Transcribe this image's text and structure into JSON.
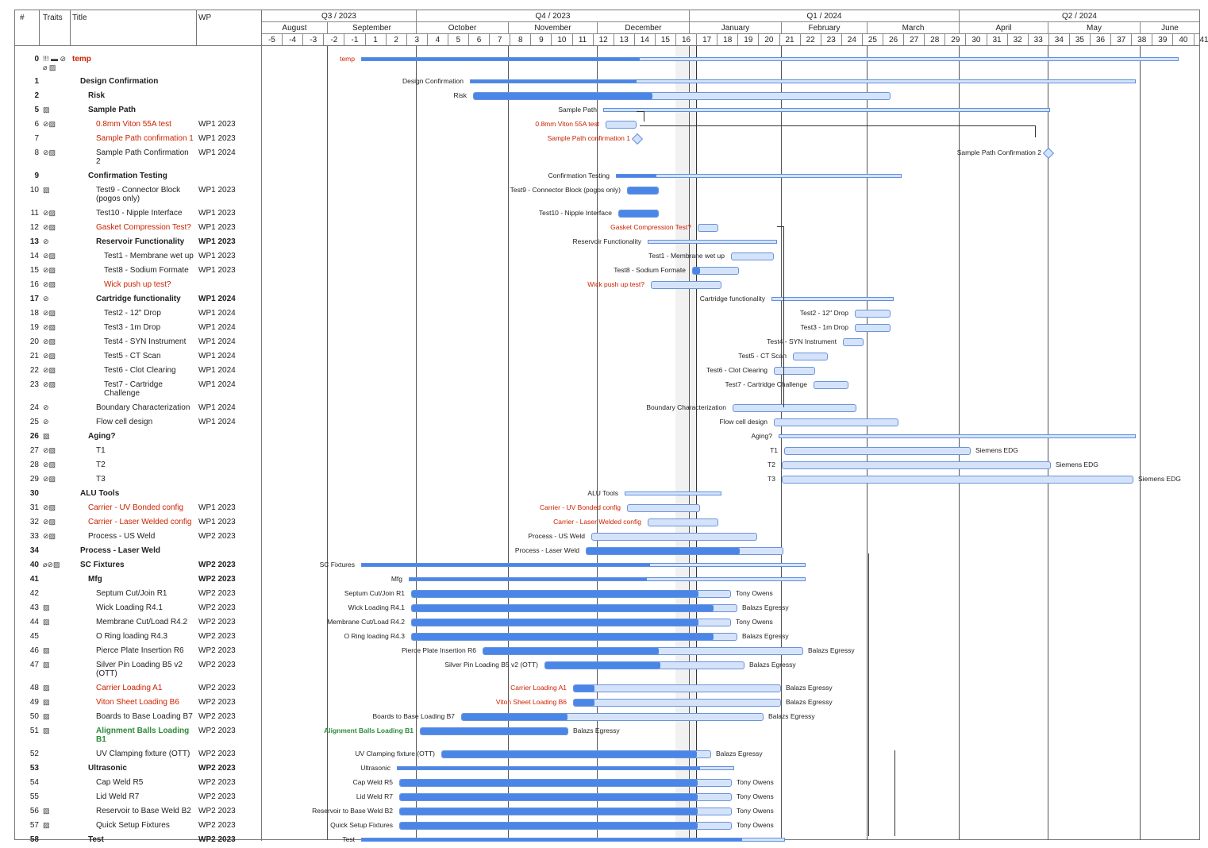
{
  "columns": {
    "num": "#",
    "traits": "Traits",
    "title": "Title",
    "wp": "WP"
  },
  "quarters": [
    "Q3 / 2023",
    "Q4 / 2023",
    "Q1 / 2024",
    "Q2 / 2024"
  ],
  "months": [
    "August",
    "September",
    "October",
    "November",
    "December",
    "January",
    "February",
    "March",
    "April",
    "May",
    "June"
  ],
  "weeks": [
    "-5",
    "-4",
    "-3",
    "-2",
    "-1",
    "1",
    "2",
    "3",
    "4",
    "5",
    "6",
    "7",
    "8",
    "9",
    "10",
    "11",
    "12",
    "13",
    "14",
    "15",
    "16",
    "17",
    "18",
    "19",
    "20",
    "21",
    "22",
    "23",
    "24",
    "25",
    "26",
    "27",
    "28",
    "29",
    "30",
    "31",
    "32",
    "33",
    "34",
    "35",
    "36",
    "37",
    "38",
    "39",
    "40",
    "41"
  ],
  "rows": [
    {
      "num": "0",
      "traits": "!!! ▬ ⊘ ⌀ ▨",
      "title": "temp",
      "wp": "",
      "style": "red-bold",
      "bar": "temp"
    },
    {
      "num": "1",
      "traits": "",
      "title": "Design Confirmation",
      "wp": "",
      "style": "bold",
      "bar": "Design Confirmation"
    },
    {
      "num": "2",
      "traits": "",
      "title": "Risk",
      "wp": "",
      "style": "bold",
      "bar": "Risk"
    },
    {
      "num": "5",
      "traits": "▨",
      "title": "Sample Path",
      "wp": "",
      "style": "bold",
      "bar": "Sample Path"
    },
    {
      "num": "6",
      "traits": "⊘▨",
      "title": "0.8mm Viton 55A test",
      "wp": "WP1 2023",
      "style": "red",
      "bar": "0.8mm Viton 55A test"
    },
    {
      "num": "7",
      "traits": "",
      "title": "Sample Path confirmation 1",
      "wp": "WP1 2023",
      "style": "red",
      "bar": "Sample Path confirmation 1"
    },
    {
      "num": "8",
      "traits": "⊘▨",
      "title": "Sample Path Confirmation 2",
      "wp": "WP1 2024",
      "style": "",
      "bar": "Sample Path Confirmation 2"
    },
    {
      "num": "9",
      "traits": "",
      "title": "Confirmation Testing",
      "wp": "",
      "style": "bold",
      "bar": "Confirmation Testing"
    },
    {
      "num": "10",
      "traits": "▨",
      "title": "Test9 - Connector Block (pogos only)",
      "wp": "WP1 2023",
      "style": "",
      "bar": "Test9 - Connector Block (pogos only)"
    },
    {
      "num": "11",
      "traits": "⊘▨",
      "title": "Test10 - Nipple Interface",
      "wp": "WP1 2023",
      "style": "",
      "bar": "Test10 - Nipple Interface"
    },
    {
      "num": "12",
      "traits": "⊘▨",
      "title": "Gasket Compression Test?",
      "wp": "WP1 2023",
      "style": "red",
      "bar": "Gasket Compression Test?"
    },
    {
      "num": "13",
      "traits": "⊘",
      "title": "Reservoir Functionality",
      "wp": "WP1 2023",
      "style": "bold",
      "bar": "Reservoir Functionality"
    },
    {
      "num": "14",
      "traits": "⊘▨",
      "title": "Test1 - Membrane wet up",
      "wp": "WP1 2023",
      "style": "",
      "bar": "Test1 - Membrane wet up"
    },
    {
      "num": "15",
      "traits": "⊘▨",
      "title": "Test8 - Sodium Formate",
      "wp": "WP1 2023",
      "style": "",
      "bar": "Test8 - Sodium Formate"
    },
    {
      "num": "16",
      "traits": "⊘▨",
      "title": "Wick push up test?",
      "wp": "",
      "style": "red",
      "bar": "Wick push up test?"
    },
    {
      "num": "17",
      "traits": "⊘",
      "title": "Cartridge functionality",
      "wp": "WP1 2024",
      "style": "bold",
      "bar": "Cartridge functionality"
    },
    {
      "num": "18",
      "traits": "⊘▨",
      "title": "Test2 - 12\" Drop",
      "wp": "WP1 2024",
      "style": "",
      "bar": "Test2 - 12\" Drop"
    },
    {
      "num": "19",
      "traits": "⊘▨",
      "title": "Test3 - 1m Drop",
      "wp": "WP1 2024",
      "style": "",
      "bar": "Test3 - 1m Drop"
    },
    {
      "num": "20",
      "traits": "⊘▨",
      "title": "Test4 - SYN Instrument",
      "wp": "WP1 2024",
      "style": "",
      "bar": "Test4 - SYN Instrument"
    },
    {
      "num": "21",
      "traits": "⊘▨",
      "title": "Test5 - CT Scan",
      "wp": "WP1 2024",
      "style": "",
      "bar": "Test5 - CT Scan"
    },
    {
      "num": "22",
      "traits": "⊘▨",
      "title": "Test6 - Clot Clearing",
      "wp": "WP1 2024",
      "style": "",
      "bar": "Test6 - Clot Clearing"
    },
    {
      "num": "23",
      "traits": "⊘▨",
      "title": "Test7 - Cartridge Challenge",
      "wp": "WP1 2024",
      "style": "",
      "bar": "Test7 - Cartridge Challenge"
    },
    {
      "num": "24",
      "traits": "⊘",
      "title": "Boundary Characterization",
      "wp": "WP1 2024",
      "style": "",
      "bar": "Boundary Characterization"
    },
    {
      "num": "25",
      "traits": "⊘",
      "title": "Flow cell design",
      "wp": "WP1 2024",
      "style": "",
      "bar": "Flow cell design"
    },
    {
      "num": "26",
      "traits": "▨",
      "title": "Aging?",
      "wp": "",
      "style": "bold",
      "bar": "Aging?"
    },
    {
      "num": "27",
      "traits": "⊘▨",
      "title": "T1",
      "wp": "",
      "style": "",
      "bar": "T1"
    },
    {
      "num": "28",
      "traits": "⊘▨",
      "title": "T2",
      "wp": "",
      "style": "",
      "bar": "T2"
    },
    {
      "num": "29",
      "traits": "⊘▨",
      "title": "T3",
      "wp": "",
      "style": "",
      "bar": "T3"
    },
    {
      "num": "30",
      "traits": "",
      "title": "ALU Tools",
      "wp": "",
      "style": "bold",
      "bar": "ALU Tools"
    },
    {
      "num": "31",
      "traits": "⊘▨",
      "title": "Carrier - UV Bonded config",
      "wp": "WP1 2023",
      "style": "red",
      "bar": "Carrier - UV Bonded config"
    },
    {
      "num": "32",
      "traits": "⊘▨",
      "title": "Carrier - Laser Welded config",
      "wp": "WP1 2023",
      "style": "red",
      "bar": "Carrier - Laser Welded config"
    },
    {
      "num": "33",
      "traits": "⊘▨",
      "title": "Process - US Weld",
      "wp": "WP2 2023",
      "style": "",
      "bar": "Process - US Weld"
    },
    {
      "num": "34",
      "traits": "",
      "title": "Process - Laser Weld",
      "wp": "",
      "style": "bold",
      "bar": "Process - Laser Weld"
    },
    {
      "num": "40",
      "traits": "⌀⊘▨",
      "title": "SC Fixtures",
      "wp": "WP2 2023",
      "style": "bold",
      "bar": "SC Fixtures"
    },
    {
      "num": "41",
      "traits": "",
      "title": "Mfg",
      "wp": "WP2 2023",
      "style": "bold",
      "bar": "Mfg"
    },
    {
      "num": "42",
      "traits": "",
      "title": "Septum Cut/Join R1",
      "wp": "WP2 2023",
      "style": "",
      "bar": "Septum Cut/Join R1"
    },
    {
      "num": "43",
      "traits": "▨",
      "title": "Wick Loading R4.1",
      "wp": "WP2 2023",
      "style": "",
      "bar": "Wick Loading R4.1"
    },
    {
      "num": "44",
      "traits": "▨",
      "title": "Membrane Cut/Load R4.2",
      "wp": "WP2 2023",
      "style": "",
      "bar": "Membrane Cut/Load R4.2"
    },
    {
      "num": "45",
      "traits": "",
      "title": "O Ring loading R4.3",
      "wp": "WP2 2023",
      "style": "",
      "bar": "O Ring loading R4.3"
    },
    {
      "num": "46",
      "traits": "▨",
      "title": "Pierce Plate Insertion R6",
      "wp": "WP2 2023",
      "style": "",
      "bar": "Pierce Plate Insertion R6"
    },
    {
      "num": "47",
      "traits": "▨",
      "title": "Silver Pin Loading B5 v2 (OTT)",
      "wp": "WP2 2023",
      "style": "",
      "bar": "Silver Pin Loading B5 v2 (OTT)"
    },
    {
      "num": "48",
      "traits": "▨",
      "title": "Carrier Loading A1",
      "wp": "WP2 2023",
      "style": "red",
      "bar": "Carrier Loading A1"
    },
    {
      "num": "49",
      "traits": "▨",
      "title": "Viton Sheet Loading B6",
      "wp": "WP2 2023",
      "style": "red",
      "bar": "Viton Sheet Loading B6"
    },
    {
      "num": "50",
      "traits": "▨",
      "title": "Boards to Base Loading B7",
      "wp": "WP2 2023",
      "style": "",
      "bar": "Boards to Base Loading B7"
    },
    {
      "num": "51",
      "traits": "▨",
      "title": "Alignment Balls Loading B1",
      "wp": "WP2 2023",
      "style": "green",
      "bar": "Alignment Balls Loading B1"
    },
    {
      "num": "52",
      "traits": "",
      "title": "UV Clamping fixture (OTT)",
      "wp": "WP2 2023",
      "style": "",
      "bar": "UV Clamping fixture (OTT)"
    },
    {
      "num": "53",
      "traits": "",
      "title": "Ultrasonic",
      "wp": "WP2 2023",
      "style": "bold",
      "bar": "Ultrasonic"
    },
    {
      "num": "54",
      "traits": "",
      "title": "Cap Weld R5",
      "wp": "WP2 2023",
      "style": "",
      "bar": "Cap Weld R5"
    },
    {
      "num": "55",
      "traits": "",
      "title": "Lid Weld R7",
      "wp": "WP2 2023",
      "style": "",
      "bar": "Lid Weld R7"
    },
    {
      "num": "56",
      "traits": "▨",
      "title": "Reservoir to Base Weld B2",
      "wp": "WP2 2023",
      "style": "",
      "bar": "Reservoir to Base Weld B2"
    },
    {
      "num": "57",
      "traits": "▨",
      "title": "Quick Setup Fixtures",
      "wp": "WP2 2023",
      "style": "",
      "bar": "Quick Setup Fixtures"
    },
    {
      "num": "58",
      "traits": "",
      "title": "Test",
      "wp": "WP2 2023",
      "style": "bold",
      "bar": "Test"
    }
  ],
  "assignees": {
    "Septum Cut/Join R1": "Tony Owens",
    "Wick Loading R4.1": "Balazs Egressy",
    "Membrane Cut/Load R4.2": "Tony Owens",
    "O Ring loading R4.3": "Balazs Egressy",
    "Pierce Plate Insertion R6": "Balazs Egressy",
    "Silver Pin Loading B5 v2 (OTT)": "Balazs Egressy",
    "Carrier Loading A1": "Balazs Egressy",
    "Viton Sheet Loading B6": "Balazs Egressy",
    "Boards to Base Loading B7": "Balazs Egressy",
    "Alignment Balls Loading B1": "Balazs Egressy",
    "UV Clamping fixture (OTT)": "Balazs Egressy",
    "Cap Weld R5": "Tony Owens",
    "Lid Weld R7": "Tony Owens",
    "Reservoir to Base Weld B2": "Tony Owens",
    "Quick Setup Fixtures": "Tony Owens",
    "T1": "Siemens EDG",
    "T2": "Siemens EDG",
    "T3": "Siemens EDG"
  },
  "colors": {
    "bar_done": "#4a86e8",
    "bar_remaining": "#d5e3fa",
    "red_text": "#cc2200",
    "green_text": "#2e8a3a"
  }
}
